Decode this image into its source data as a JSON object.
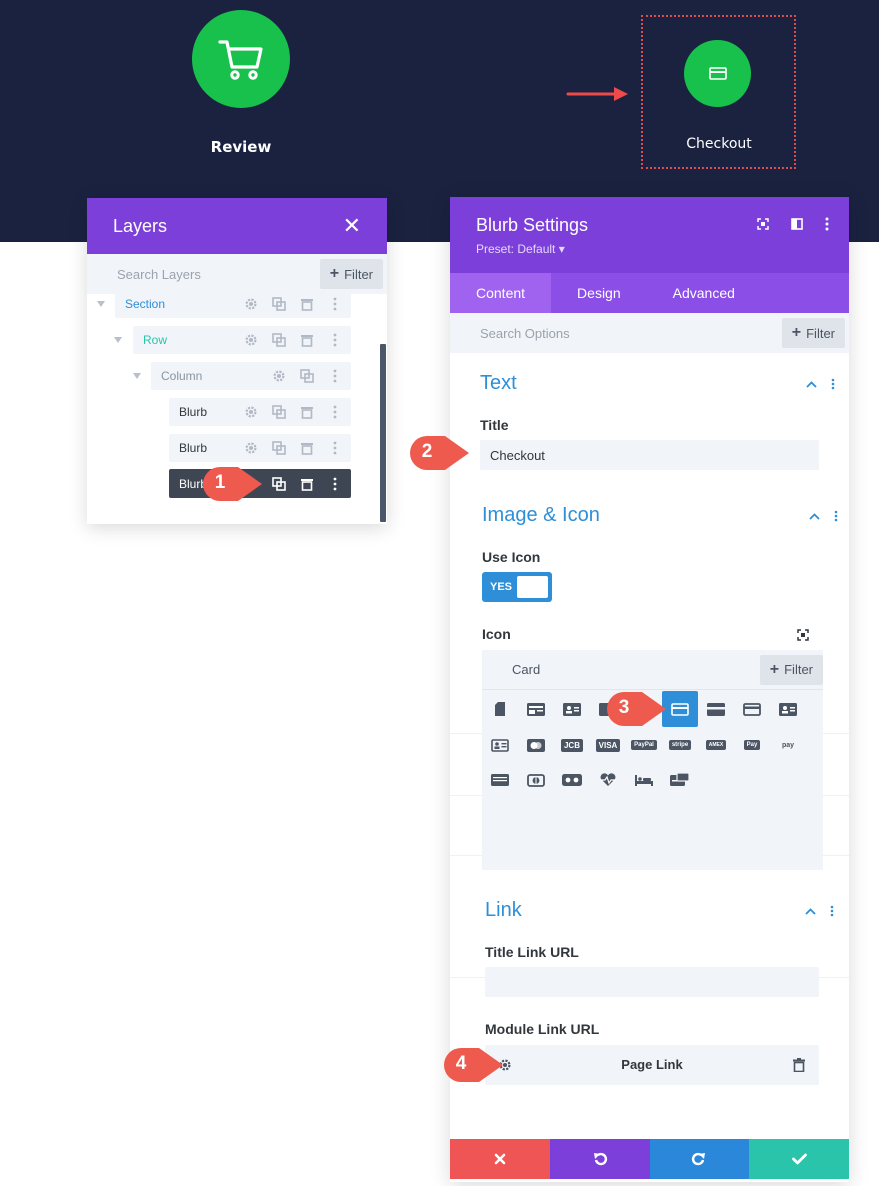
{
  "hero": {
    "review_label": "Review",
    "checkout_label": "Checkout",
    "review_icon": "cart-icon",
    "checkout_icon": "card-icon",
    "accent": "#18c14b",
    "background": "#1a2240"
  },
  "layers": {
    "title": "Layers",
    "search_placeholder": "Search Layers",
    "filter_label": "Filter",
    "items": [
      {
        "label": "Section",
        "color": "#2e8fd8"
      },
      {
        "label": "Row",
        "color": "#29c4a9"
      },
      {
        "label": "Column",
        "color": "#8a94a3"
      },
      {
        "label": "Blurb",
        "color": "#32373c"
      },
      {
        "label": "Blurb",
        "color": "#32373c"
      },
      {
        "label": "Blurb",
        "color": "#ffffff"
      }
    ]
  },
  "settings": {
    "title": "Blurb Settings",
    "preset": "Preset: Default",
    "tabs": [
      "Content",
      "Design",
      "Advanced"
    ],
    "search_placeholder": "Search Options",
    "filter_label": "Filter",
    "sections": {
      "text": {
        "title": "Text",
        "title_field_label": "Title",
        "title_value": "Checkout"
      },
      "image_icon": {
        "title": "Image & Icon",
        "use_icon_label": "Use Icon",
        "use_icon_value": "YES",
        "icon_label": "Icon",
        "icon_search_value": "Card",
        "icon_filter_label": "Filter",
        "icons": [
          "sd-card-icon",
          "id-card-icon",
          "contact-card-icon",
          "card-icon",
          "credit-card-icon",
          "card-stripe-icon",
          "card-horizontal-icon",
          "address-card-icon",
          "vcard-icon",
          "mastercard-icon",
          "jcb-icon",
          "visa-icon",
          "paypal-icon",
          "stripe-icon",
          "amex-icon",
          "apple-pay-icon",
          "amazon-pay-icon",
          "keyboard-icon",
          "diners-club-icon",
          "vr-card-icon",
          "heartbeat-icon",
          "bed-icon",
          "wallet-card-icon"
        ],
        "brand_texts": {
          "jcb": "JCB",
          "visa": "VISA",
          "paypal": "PayPal",
          "stripe": "stripe",
          "amex": "AMEX",
          "applepay": "Pay",
          "amazonpay": "pay"
        }
      },
      "link": {
        "title": "Link",
        "title_link_label": "Title Link URL",
        "title_link_value": "",
        "module_link_label": "Module Link URL",
        "module_link_value": "Page Link"
      }
    },
    "footer": {
      "cancel_color": "#ef5555",
      "undo_color": "#7c3fd9",
      "redo_color": "#2b87da",
      "save_color": "#29c4a9"
    }
  },
  "callouts": [
    "1",
    "2",
    "3",
    "4"
  ]
}
